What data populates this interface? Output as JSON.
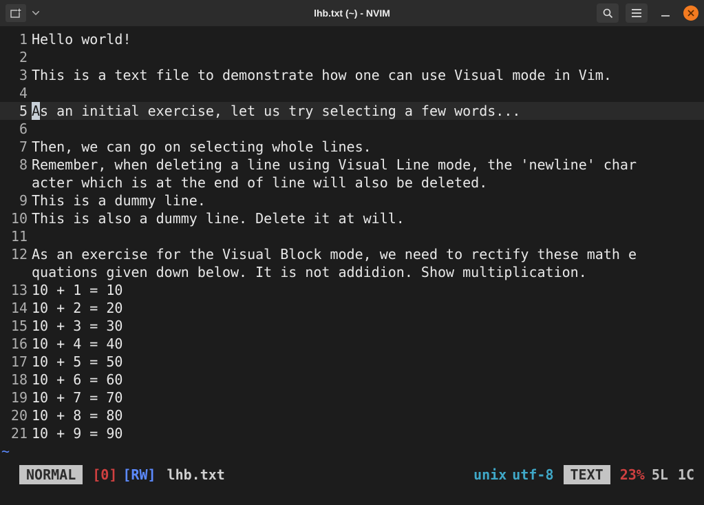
{
  "window": {
    "title": "lhb.txt (~) - NVIM"
  },
  "editor": {
    "cursor_line": 5,
    "cursor_col": 1,
    "lines": [
      {
        "n": 1,
        "text": "Hello world!"
      },
      {
        "n": 2,
        "text": ""
      },
      {
        "n": 3,
        "text": "This is a text file to demonstrate how one can use Visual mode in Vim."
      },
      {
        "n": 4,
        "text": ""
      },
      {
        "n": 5,
        "text": "As an initial exercise, let us try selecting a few words..."
      },
      {
        "n": 6,
        "text": ""
      },
      {
        "n": 7,
        "text": "Then, we can go on selecting whole lines."
      },
      {
        "n": 8,
        "text": "Remember, when deleting a line using Visual Line mode, the 'newline' character which is at the end of line will also be deleted.",
        "wrap": [
          "Remember, when deleting a line using Visual Line mode, the 'newline' char",
          "acter which is at the end of line will also be deleted."
        ]
      },
      {
        "n": 9,
        "text": "This is a dummy line."
      },
      {
        "n": 10,
        "text": "This is also a dummy line. Delete it at will."
      },
      {
        "n": 11,
        "text": ""
      },
      {
        "n": 12,
        "text": "As an exercise for the Visual Block mode, we need to rectify these math equations given down below. It is not addidion. Show multiplication.",
        "wrap": [
          "As an exercise for the Visual Block mode, we need to rectify these math e",
          "quations given down below. It is not addidion. Show multiplication."
        ]
      },
      {
        "n": 13,
        "text": "10 + 1 = 10"
      },
      {
        "n": 14,
        "text": "10 + 2 = 20"
      },
      {
        "n": 15,
        "text": "10 + 3 = 30"
      },
      {
        "n": 16,
        "text": "10 + 4 = 40"
      },
      {
        "n": 17,
        "text": "10 + 5 = 50"
      },
      {
        "n": 18,
        "text": "10 + 6 = 60"
      },
      {
        "n": 19,
        "text": "10 + 7 = 70"
      },
      {
        "n": 20,
        "text": "10 + 8 = 80"
      },
      {
        "n": 21,
        "text": "10 + 9 = 90"
      }
    ],
    "tilde": "~"
  },
  "statusline": {
    "mode": "NORMAL",
    "zero": "[0]",
    "rw": "[RW]",
    "filename": "lhb.txt",
    "fileformat": "unix",
    "encoding": "utf-8",
    "filetype": "TEXT",
    "percent": "23%",
    "line_pos": "5L",
    "col_pos": "1C"
  }
}
